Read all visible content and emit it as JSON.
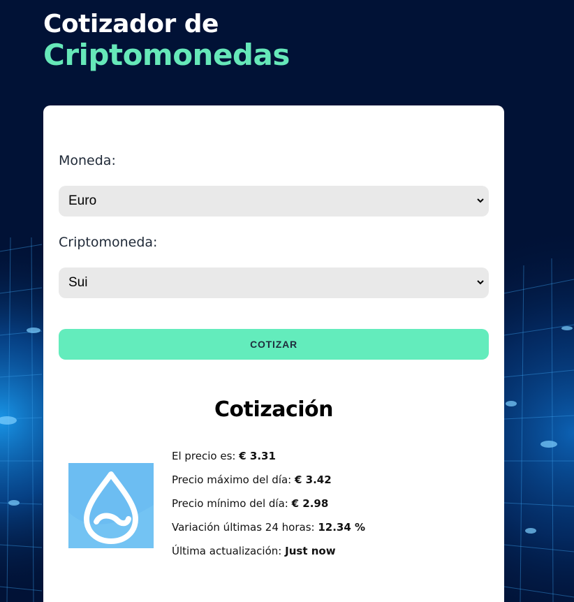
{
  "header": {
    "title_line1": "Cotizador de",
    "title_line2": "Criptomonedas"
  },
  "form": {
    "currency_label": "Moneda:",
    "currency_value": "Euro",
    "crypto_label": "Criptomoneda:",
    "crypto_value": "Sui",
    "submit_label": "COTIZAR"
  },
  "result": {
    "title": "Cotización",
    "logo_icon": "sui-logo-icon",
    "price_label": "El precio es:",
    "price_value": "€ 3.31",
    "high_label": "Precio máximo del día:",
    "high_value": "€ 3.42",
    "low_label": "Precio mínimo del día:",
    "low_value": "€ 2.98",
    "change_label": "Variación últimas 24 horas:",
    "change_value": "12.34 %",
    "updated_label": "Última actualización:",
    "updated_value": "Just now"
  },
  "colors": {
    "background": "#011236",
    "accent": "#66e8b9",
    "button": "#63ecbc",
    "logo_bg": "#6cbdf2"
  }
}
